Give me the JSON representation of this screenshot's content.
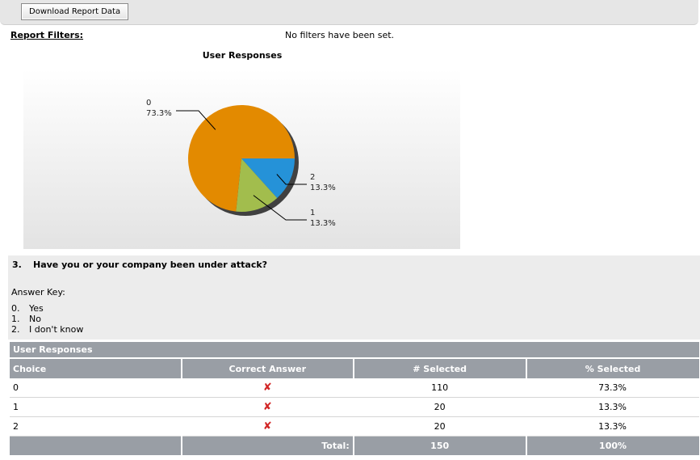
{
  "toolbar": {
    "download_label": "Download Report Data"
  },
  "filters": {
    "label": "Report Filters:",
    "value": "No filters have been set."
  },
  "chart_data": {
    "type": "pie",
    "title": "User Responses",
    "categories": [
      "0",
      "1",
      "2"
    ],
    "values": [
      73.3,
      13.3,
      13.3
    ],
    "labels": [
      "73.3%",
      "13.3%",
      "13.3%"
    ],
    "colors": [
      "#e38a00",
      "#a2bd4d",
      "#2592d8"
    ]
  },
  "question": {
    "number": "3.",
    "text": "Have you or your company been under attack?",
    "answer_key_title": "Answer Key:",
    "answer_key": [
      {
        "num": "0.",
        "text": "Yes"
      },
      {
        "num": "1.",
        "text": "No"
      },
      {
        "num": "2.",
        "text": "I don't know"
      }
    ]
  },
  "table": {
    "caption": "User Responses",
    "headers": [
      "Choice",
      "Correct Answer",
      "# Selected",
      "% Selected"
    ],
    "rows": [
      {
        "choice": "0",
        "correct": "✘",
        "selected": "110",
        "percent": "73.3%"
      },
      {
        "choice": "1",
        "correct": "✘",
        "selected": "20",
        "percent": "13.3%"
      },
      {
        "choice": "2",
        "correct": "✘",
        "selected": "20",
        "percent": "13.3%"
      }
    ],
    "total": {
      "label": "Total:",
      "selected": "150",
      "percent": "100%"
    }
  }
}
